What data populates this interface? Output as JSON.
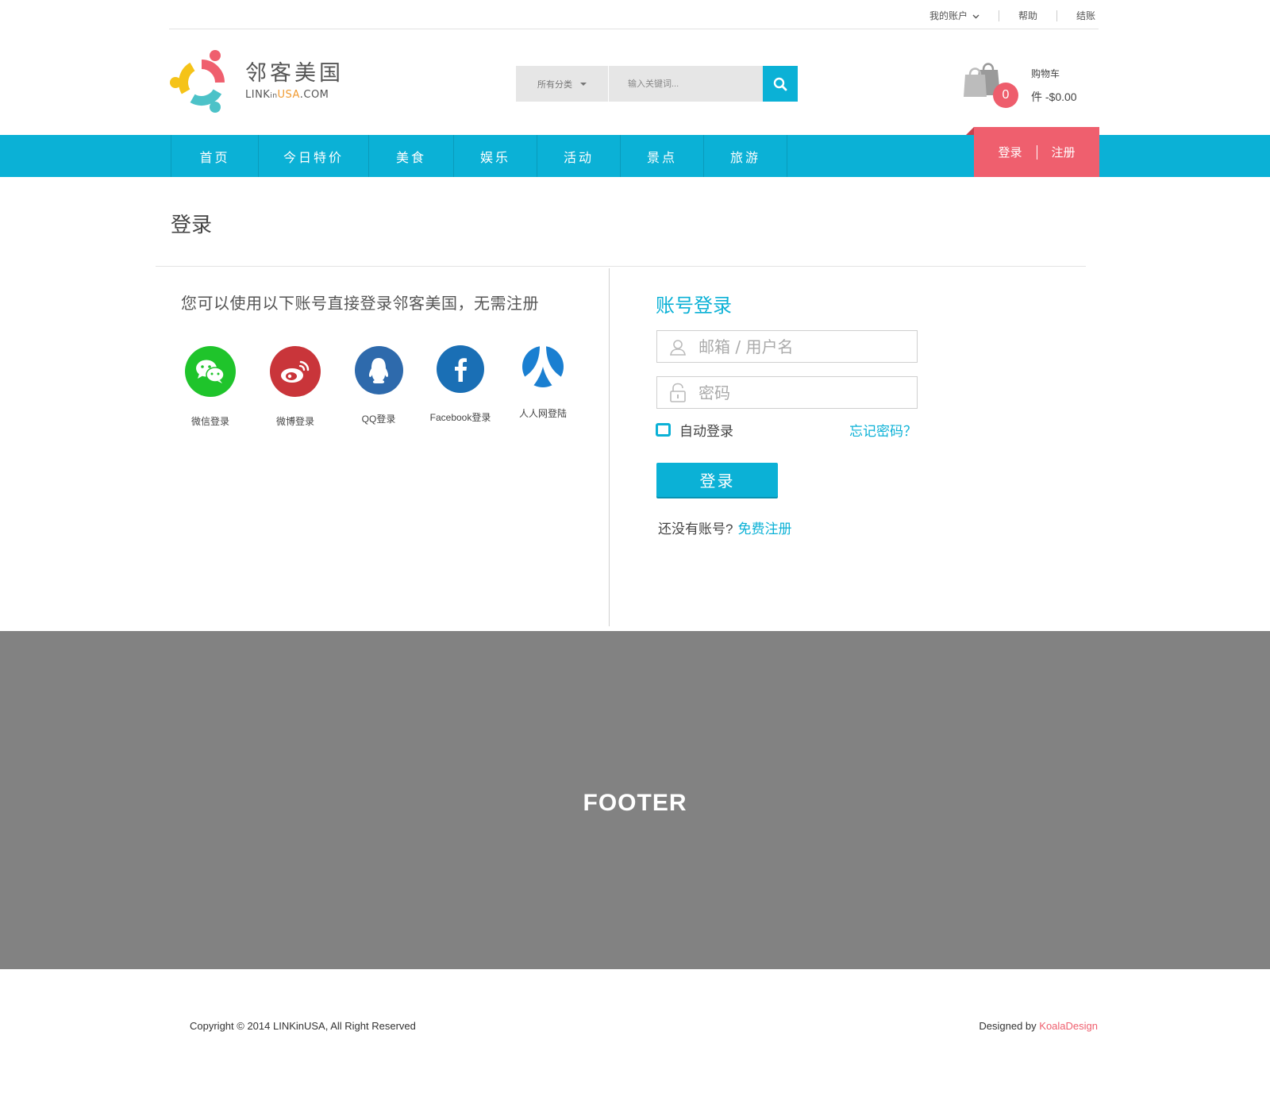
{
  "topbar": {
    "account": "我的账户",
    "help": "帮助",
    "checkout": "结账"
  },
  "logo": {
    "cn": "邻客美国",
    "en_prefix": "LINK",
    "en_in": "in",
    "en_usa": "USA",
    "en_suffix": ".COM"
  },
  "search": {
    "category": "所有分类",
    "placeholder": "输入关键词..."
  },
  "cart": {
    "title": "购物车",
    "count": "0",
    "amount": "件 -$0.00"
  },
  "nav": {
    "items": [
      "首页",
      "今日特价",
      "美食",
      "娱乐",
      "活动",
      "景点",
      "旅游"
    ]
  },
  "auth": {
    "login": "登录",
    "register": "注册"
  },
  "page": {
    "title": "登录"
  },
  "social": {
    "title": "您可以使用以下账号直接登录邻客美国，无需注册",
    "items": [
      {
        "label": "微信登录",
        "icon": "wechat-icon",
        "color": "#1fc42b"
      },
      {
        "label": "微博登录",
        "icon": "weibo-icon",
        "color": "#c9353a"
      },
      {
        "label": "QQ登录",
        "icon": "qq-icon",
        "color": "#2e6aac"
      },
      {
        "label": "Facebook登录",
        "icon": "facebook-icon",
        "color": "#1a6fb5"
      },
      {
        "label": "人人网登陆",
        "icon": "renren-icon",
        "color": "#1a7fd1"
      }
    ]
  },
  "login": {
    "title": "账号登录",
    "username_placeholder": "邮箱 / 用户名",
    "password_placeholder": "密码",
    "remember": "自动登录",
    "forgot": "忘记密码？",
    "submit": "登录",
    "no_account": "还没有账号?",
    "register": "免费注册"
  },
  "footer": {
    "label": "FOOTER",
    "copyright": "Copyright © 2014 LINKinUSA,  All Right Reserved",
    "designed_by": "Designed by ",
    "designer": "KoalaDesign"
  },
  "colors": {
    "accent": "#0bb1d6",
    "brand_red": "#ef5f6e",
    "footer_bg": "#828282"
  }
}
